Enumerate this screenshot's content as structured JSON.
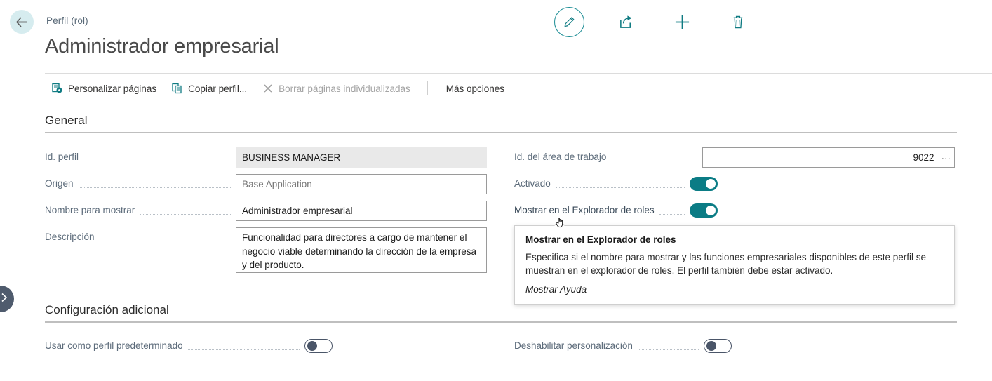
{
  "header": {
    "back_icon": "arrow-left-icon",
    "breadcrumb": "Perfil (rol)",
    "title": "Administrador empresarial",
    "actions": [
      {
        "name": "edit",
        "icon": "pencil-icon"
      },
      {
        "name": "share",
        "icon": "share-icon"
      },
      {
        "name": "new",
        "icon": "plus-icon"
      },
      {
        "name": "delete",
        "icon": "trash-icon"
      }
    ]
  },
  "action_bar": {
    "items": [
      {
        "label": "Personalizar páginas",
        "icon": "customize-pages-icon",
        "disabled": false
      },
      {
        "label": "Copiar perfil...",
        "icon": "copy-icon",
        "disabled": false
      },
      {
        "label": "Borrar páginas individualizadas",
        "icon": "close-x-icon",
        "disabled": true
      }
    ],
    "more_options": "Más opciones"
  },
  "general": {
    "title": "General",
    "profile_id": {
      "label": "Id. perfil",
      "value": "BUSINESS MANAGER",
      "readonly": true
    },
    "origin": {
      "label": "Origen",
      "value": "",
      "placeholder": "Base Application"
    },
    "display_name": {
      "label": "Nombre para mostrar",
      "value": "Administrador empresarial"
    },
    "description": {
      "label": "Descripción",
      "value": "Funcionalidad para directores a cargo de mantener el negocio viable determinando la dirección de la empresa y del producto."
    },
    "workspace_id": {
      "label": "Id. del área de trabajo",
      "value": "9022",
      "lookup": "…"
    },
    "enabled": {
      "label": "Activado",
      "state": "on"
    },
    "show_in_role_explorer": {
      "label": "Mostrar en el Explorador de roles",
      "state": "on"
    }
  },
  "additional": {
    "title": "Configuración adicional",
    "default_profile": {
      "label": "Usar como perfil predeterminado",
      "state": "off"
    },
    "disable_personalization": {
      "label": "Deshabilitar personalización",
      "state": "off"
    }
  },
  "tooltip": {
    "title": "Mostrar en el Explorador de roles",
    "body": "Especifica si el nombre para mostrar y las funciones empresariales disponibles de este perfil se muestran en el explorador de roles. El perfil también debe estar activado.",
    "link": "Mostrar Ayuda"
  },
  "colors": {
    "accent_teal": "#0b7c85",
    "back_circle": "#d6ecef",
    "label_gray": "#5c6b7a",
    "readonly_bg": "#e9e9e9",
    "handle": "#4f5b6d"
  }
}
